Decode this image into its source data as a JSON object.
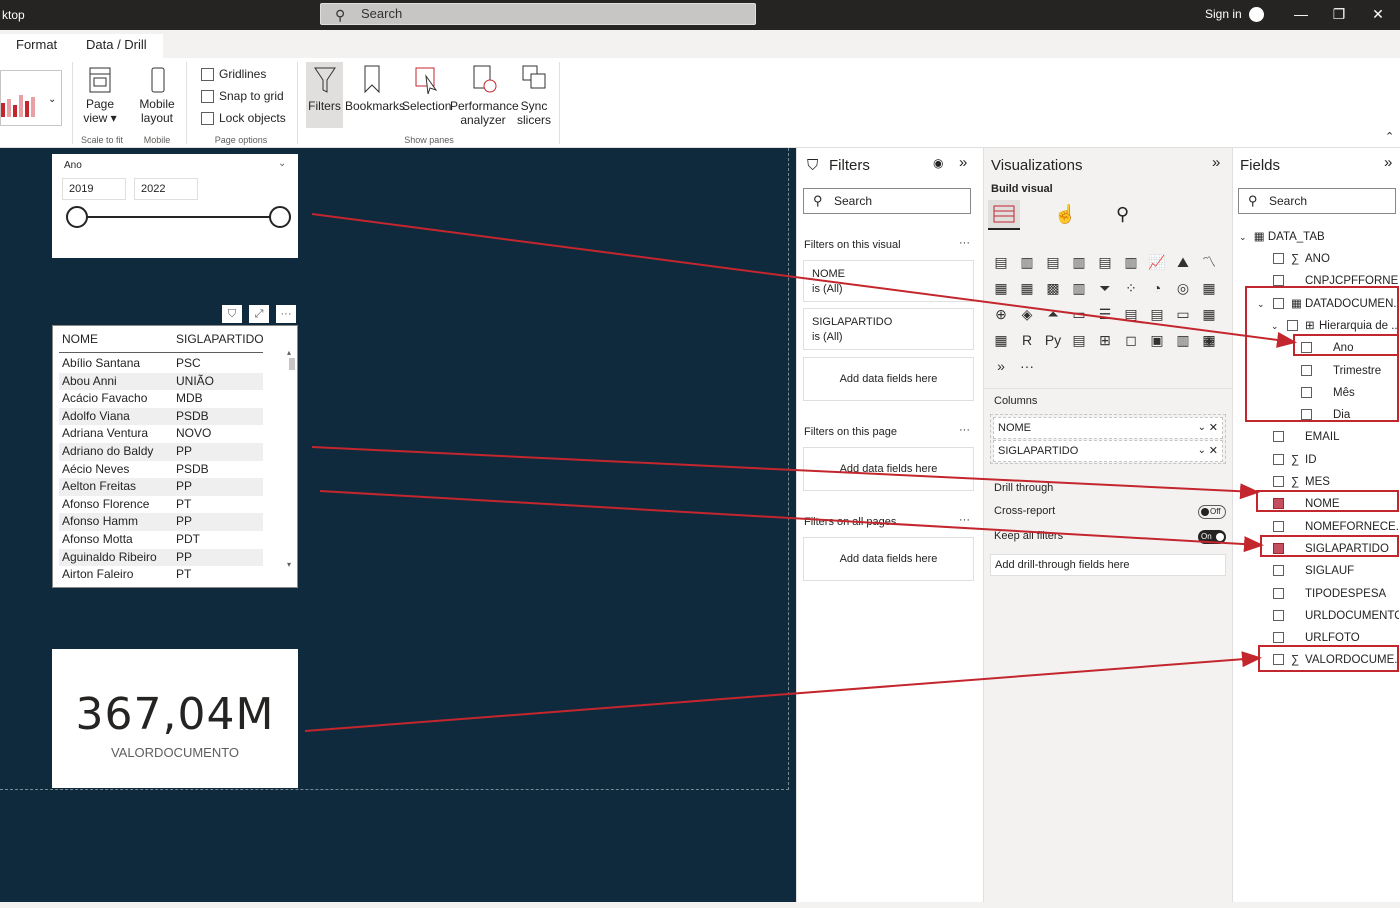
{
  "titlebar": {
    "app_title": "ktop",
    "search_placeholder": "Search",
    "signin": "Sign in",
    "minimize": "—",
    "restore": "❐",
    "close": "✕"
  },
  "ribbon": {
    "tabs": [
      "Format",
      "Data / Drill"
    ],
    "page_view": "Page view",
    "page_view_sub": "view",
    "page_view_top": "Page",
    "mobile_top": "Mobile",
    "mobile_bot": "layout",
    "scale_group": "Scale to fit",
    "mobile_group": "Mobile",
    "checks": [
      "Gridlines",
      "Snap to grid",
      "Lock objects"
    ],
    "page_options": "Page options",
    "panes": [
      "Filters",
      "Bookmarks",
      "Selection"
    ],
    "perf_top": "Performance",
    "perf_bot": "analyzer",
    "sync_top": "Sync",
    "sync_bot": "slicers",
    "show_panes": "Show panes"
  },
  "slicer": {
    "title": "Ano",
    "from": "2019",
    "to": "2022"
  },
  "table": {
    "headers": [
      "NOME",
      "SIGLAPARTIDO"
    ],
    "rows": [
      [
        "Abílio Santana",
        "PSC"
      ],
      [
        "Abou Anni",
        "UNIÃO"
      ],
      [
        "Acácio Favacho",
        "MDB"
      ],
      [
        "Adolfo Viana",
        "PSDB"
      ],
      [
        "Adriana Ventura",
        "NOVO"
      ],
      [
        "Adriano do Baldy",
        "PP"
      ],
      [
        "Aécio Neves",
        "PSDB"
      ],
      [
        "Aelton Freitas",
        "PP"
      ],
      [
        "Afonso Florence",
        "PT"
      ],
      [
        "Afonso Hamm",
        "PP"
      ],
      [
        "Afonso Motta",
        "PDT"
      ],
      [
        "Aguinaldo Ribeiro",
        "PP"
      ],
      [
        "Airton Faleiro",
        "PT"
      ]
    ]
  },
  "kpi": {
    "value": "367,04M",
    "label": "VALORDOCUMENTO"
  },
  "filters": {
    "title": "Filters",
    "search": "Search",
    "on_visual": "Filters on this visual",
    "cards": [
      {
        "name": "NOME",
        "state": "is (All)"
      },
      {
        "name": "SIGLAPARTIDO",
        "state": "is (All)"
      }
    ],
    "add": "Add data fields here",
    "on_page": "Filters on this page",
    "on_all": "Filters on all pages"
  },
  "viz": {
    "title": "Visualizations",
    "build": "Build visual",
    "columns": "Columns",
    "wells": [
      "NOME",
      "SIGLAPARTIDO"
    ],
    "drill": "Drill through",
    "cross": "Cross-report",
    "cross_state": "Off",
    "keep": "Keep all filters",
    "keep_state": "On",
    "add_drill": "Add drill-through fields here",
    "r": "R",
    "py": "Py",
    "more": "···"
  },
  "fields": {
    "title": "Fields",
    "search": "Search",
    "table": "DATA_TAB",
    "items": [
      {
        "label": "ANO",
        "sigma": true,
        "checked": false
      },
      {
        "label": "CNPJCPFFORNE...",
        "sigma": false,
        "checked": false
      },
      {
        "label": "DATADOCUMEN...",
        "sigma": false,
        "checked": false
      },
      {
        "label": "Hierarquia de ...",
        "sigma": false,
        "checked": false
      },
      {
        "label": "Ano",
        "sigma": false,
        "checked": false
      },
      {
        "label": "Trimestre",
        "sigma": false,
        "checked": false
      },
      {
        "label": "Mês",
        "sigma": false,
        "checked": false
      },
      {
        "label": "Dia",
        "sigma": false,
        "checked": false
      },
      {
        "label": "EMAIL",
        "sigma": false,
        "checked": false
      },
      {
        "label": "ID",
        "sigma": true,
        "checked": false
      },
      {
        "label": "MES",
        "sigma": true,
        "checked": false
      },
      {
        "label": "NOME",
        "sigma": false,
        "checked": true
      },
      {
        "label": "NOMEFORNECE...",
        "sigma": false,
        "checked": false
      },
      {
        "label": "SIGLAPARTIDO",
        "sigma": false,
        "checked": true
      },
      {
        "label": "SIGLAUF",
        "sigma": false,
        "checked": false
      },
      {
        "label": "TIPODESPESA",
        "sigma": false,
        "checked": false
      },
      {
        "label": "URLDOCUMENTO",
        "sigma": false,
        "checked": false
      },
      {
        "label": "URLFOTO",
        "sigma": false,
        "checked": false
      },
      {
        "label": "VALORDOCUME...",
        "sigma": true,
        "checked": false
      }
    ]
  },
  "colors": {
    "accent": "#c4262e",
    "canvas": "#0f2a3d",
    "check_on": "#c4505f"
  }
}
